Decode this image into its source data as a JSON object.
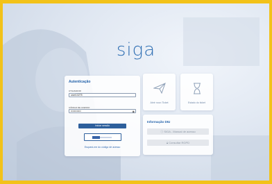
{
  "app": {
    "logo": "siga"
  },
  "auth": {
    "title": "Autenticação",
    "user_label": "UTILIZADOR",
    "user_value": "user10275",
    "password_label": "CÓDIGO DE ACESSO",
    "password_value": "••••••••••••",
    "login_button": "Iniciar sessão",
    "forgot_link": "Esqueci-me do código de acesso"
  },
  "tiles": {
    "ticket": "Abrir novo Ticket",
    "ticket_status": "Estado do ticket"
  },
  "info": {
    "title": "Informação DIU",
    "manual": "SIGA - Manual de acesso",
    "rgpd": "Consultar RGPD"
  },
  "icons": {
    "ticket": "paper-plane-icon",
    "status": "hourglass-icon",
    "manual": "info-icon",
    "rgpd": "lock-icon",
    "password_toggle": "eye-icon",
    "gov": "gov-auth-logo"
  },
  "colors": {
    "frame": "#f2c219",
    "accent": "#2d5f9c",
    "brand": "#2f6fb3"
  }
}
